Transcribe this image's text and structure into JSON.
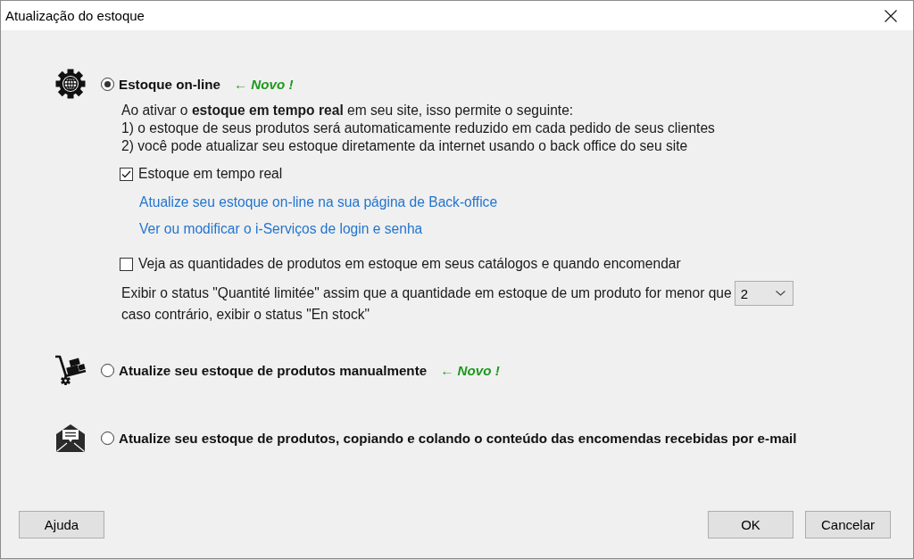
{
  "window": {
    "title": "Atualização do estoque"
  },
  "options": [
    {
      "kind": "online",
      "label": "Estoque on-line",
      "selected": true,
      "badge": "← Novo !",
      "details": {
        "description": [
          "Ao ativar o **estoque em tempo real** em seu site, isso permite o seguinte:",
          "1) o estoque de seus produtos será automaticamente reduzido em cada pedido de seus clientes",
          "2) você pode atualizar seu estoque diretamente da internet usando o back office do seu site"
        ],
        "realtime": {
          "label": "Estoque em tempo real",
          "checked": true
        },
        "links": [
          "Atualize seu estoque on-line na sua página de Back-office",
          "Ver ou modificar o i-Serviços de login e senha"
        ],
        "show_quantities": {
          "label": "Veja as quantidades de produtos em estoque em seus catálogos e quando encomendar",
          "checked": false
        },
        "threshold": {
          "text": "Exibir o status \"Quantité limitée\" assim que a quantidade em estoque de um produto for menor que",
          "value": "2",
          "otherwise": "caso contrário, exibir o status \"En stock\""
        }
      }
    },
    {
      "kind": "manual",
      "label": "Atualize seu estoque de produtos manualmente",
      "selected": false,
      "badge": "← Novo !"
    },
    {
      "kind": "email",
      "label": "Atualize seu estoque de produtos, copiando e colando o conteúdo das encomendas recebidas por e-mail",
      "selected": false
    }
  ],
  "footer": {
    "left": [
      "Ajuda"
    ],
    "right": [
      "OK",
      "Cancelar"
    ]
  }
}
